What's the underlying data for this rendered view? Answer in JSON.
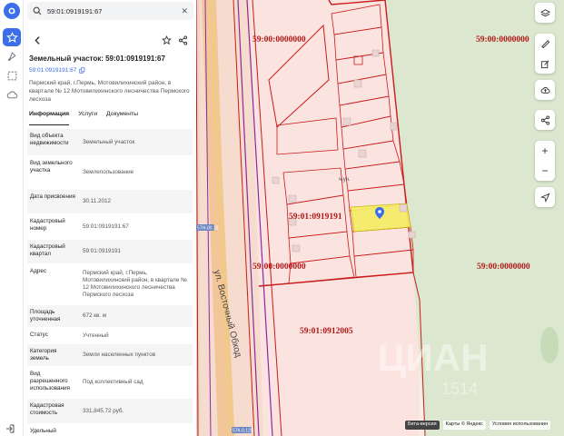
{
  "search": {
    "value": "59:01:0919191:67"
  },
  "parcel": {
    "title": "Земельный участок: 59:01:0919191:67",
    "cad_link": "59:01:0919191:67",
    "address": "Пермский край, г.Пермь, Мотовилихинский район, в квартале № 12 Мотовилихинского лесничества Пермского лесхоза"
  },
  "tabs": [
    "Информация",
    "Услуги",
    "Документы"
  ],
  "props": [
    {
      "k": "Вид объекта недвижимости",
      "v": "Земельный участок"
    },
    {
      "k": "Вид земельного участка",
      "v": "Землепользование"
    },
    {
      "k": "Дата присвоения",
      "v": "30.11.2012"
    },
    {
      "k": "Кадастровый номер",
      "v": "59:01:0919191:67"
    },
    {
      "k": "Кадастровый квартал",
      "v": "59:01:0919191"
    },
    {
      "k": "Адрес",
      "v": "Пермский край, г.Пермь, Мотовилихинский район, в квартале № 12 Мотовилихинского лесничества Пермского лесхоза"
    },
    {
      "k": "Площадь уточненная",
      "v": "672 кв. м"
    },
    {
      "k": "Статус",
      "v": "Учтенный"
    },
    {
      "k": "Категория земель",
      "v": "Земли населенных пунктов"
    },
    {
      "k": "Вид разрешенного использования",
      "v": "Под коллективный сад"
    },
    {
      "k": "Кадастровая стоимость",
      "v": "331,845.72 руб."
    },
    {
      "k": "Удельный",
      "v": ""
    }
  ],
  "map": {
    "labels": {
      "z1": "59:00:0000000",
      "z2": "59:00:0000000",
      "z3": "59:00:0000000",
      "z4": "59:00:0000000",
      "quarter": "59:01:0919191",
      "block": "59:01:0912005",
      "road": "ул. Восточный Обход",
      "road_badge_top": "57Н-00.18",
      "road_badge_bottom": "57К-0.128",
      "small_note": "ч.уч.",
      "watermark": "ЦИАН",
      "watermark_num": "1514"
    }
  },
  "attribution": {
    "beta": "Бета-версия",
    "maps": "Карты © Яндекс",
    "terms": "Условия использования"
  },
  "colors": {
    "accent": "#3b6ee8",
    "boundary": "#d01c1c",
    "parcel_fill": "#fbe7e5",
    "selected": "#f4ec6a"
  }
}
